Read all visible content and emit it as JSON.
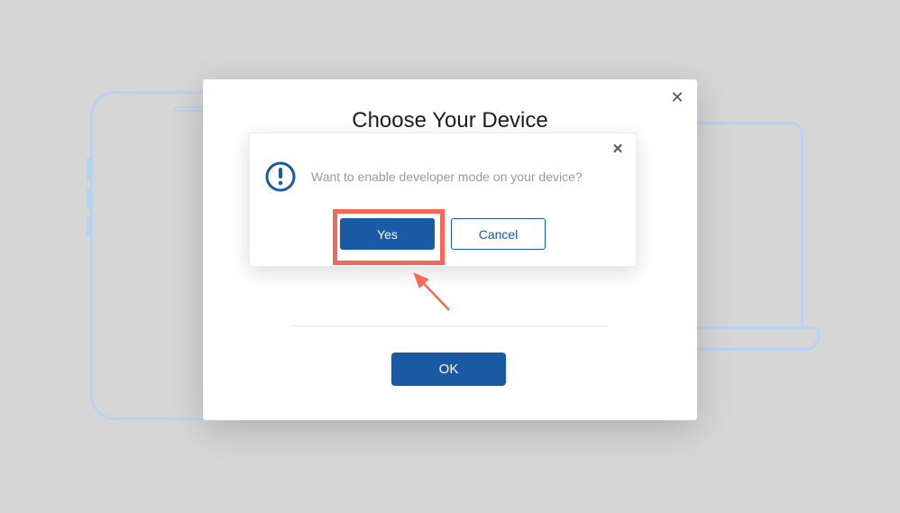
{
  "modal": {
    "title": "Choose Your Device",
    "ok_label": "OK",
    "close_glyph": "✕"
  },
  "confirm": {
    "message": "Want to enable developer mode on your device?",
    "yes_label": "Yes",
    "cancel_label": "Cancel",
    "close_glyph": "✕"
  },
  "colors": {
    "primary": "#1b5aa5",
    "annotation": "#f46a5a",
    "outline": "#b9d2ee"
  }
}
